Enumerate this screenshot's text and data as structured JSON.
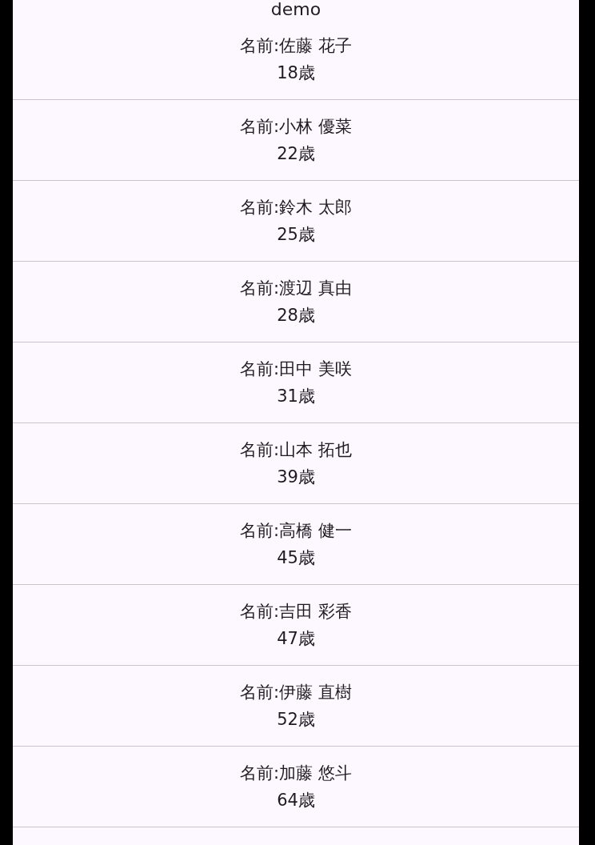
{
  "app_bar": {
    "title": "demo"
  },
  "people": [
    {
      "name": "名前:佐藤 花子",
      "age": "18歳"
    },
    {
      "name": "名前:小林 優菜",
      "age": "22歳"
    },
    {
      "name": "名前:鈴木 太郎",
      "age": "25歳"
    },
    {
      "name": "名前:渡辺 真由",
      "age": "28歳"
    },
    {
      "name": "名前:田中 美咲",
      "age": "31歳"
    },
    {
      "name": "名前:山本 拓也",
      "age": "39歳"
    },
    {
      "name": "名前:高橋 健一",
      "age": "45歳"
    },
    {
      "name": "名前:吉田 彩香",
      "age": "47歳"
    },
    {
      "name": "名前:伊藤 直樹",
      "age": "52歳"
    },
    {
      "name": "名前:加藤 悠斗",
      "age": "64歳"
    }
  ]
}
